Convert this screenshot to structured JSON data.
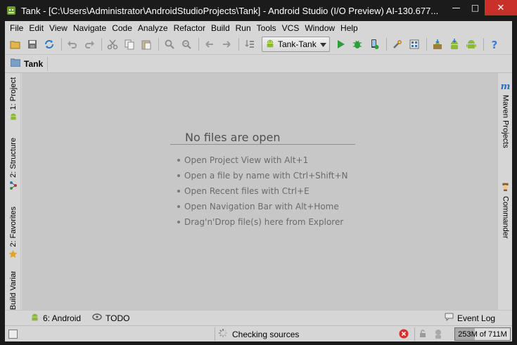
{
  "window": {
    "title": "Tank - [C:\\Users\\Administrator\\AndroidStudioProjects\\Tank] - Android Studio (I/O Preview) AI-130.677...",
    "minimize_glyph": "—",
    "maximize_glyph": "□",
    "close_glyph": "✕"
  },
  "menu": [
    "File",
    "Edit",
    "View",
    "Navigate",
    "Code",
    "Analyze",
    "Refactor",
    "Build",
    "Run",
    "Tools",
    "VCS",
    "Window",
    "Help"
  ],
  "toolbar": {
    "run_config": "Tank-Tank",
    "icons": [
      "open-folder-icon",
      "save-icon",
      "sync-icon",
      "undo-icon",
      "redo-icon",
      "cut-icon",
      "copy-icon",
      "paste-icon",
      "find-icon",
      "replace-icon",
      "back-icon",
      "forward-icon",
      "make-project-icon",
      "run-config-combo",
      "run-icon",
      "debug-icon",
      "attach-debugger-icon",
      "settings-icon",
      "project-structure-icon",
      "sdk-manager-icon",
      "avd-manager-icon",
      "android-sync-icon",
      "help-icon"
    ]
  },
  "navbar": {
    "crumb": "Tank"
  },
  "left_tabs": [
    {
      "label": "1: Project",
      "icon": "android-icon"
    },
    {
      "label": "2: Structure",
      "icon": "structure-icon"
    },
    {
      "label": "2: Favorites",
      "icon": "star-icon"
    },
    {
      "label": "Build Variants",
      "icon": ""
    }
  ],
  "right_tabs": [
    {
      "label": "Maven Projects",
      "icon": "maven-icon"
    },
    {
      "label": "Commander",
      "icon": "commander-icon"
    }
  ],
  "editor": {
    "empty_title": "No files are open",
    "tips": [
      "Open Project View with Alt+1",
      "Open a file by name with Ctrl+Shift+N",
      "Open Recent files with Ctrl+E",
      "Open Navigation Bar with Alt+Home",
      "Drag'n'Drop file(s) here from Explorer"
    ]
  },
  "bottom_tabs": {
    "android": "6: Android",
    "todo": "TODO",
    "event_log": "Event Log"
  },
  "status": {
    "progress_text": "Checking sources",
    "memory": "253M of 711M",
    "memory_used_mb": 253,
    "memory_total_mb": 711
  },
  "colors": {
    "android_green": "#8cb83b",
    "run_green": "#2e9e3b",
    "cancel_red": "#d9302b",
    "help_blue": "#3b7dd8",
    "maven_blue": "#2a6fb8"
  }
}
